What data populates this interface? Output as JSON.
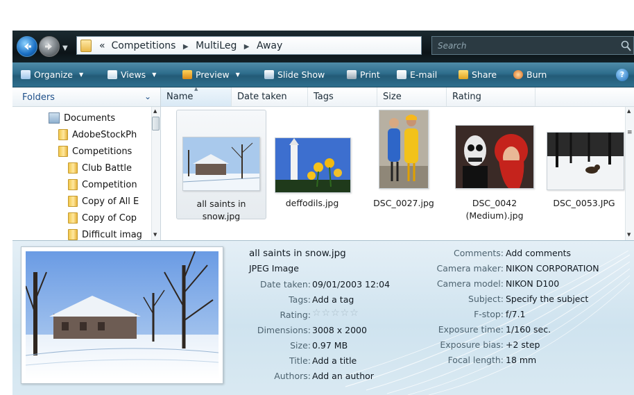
{
  "address": {
    "path": [
      "Competitions",
      "MultiLeg",
      "Away"
    ],
    "chevron": "«",
    "search_placeholder": "Search"
  },
  "toolbar": {
    "items": [
      {
        "label": "Organize",
        "icon": "organize-icon",
        "dropdown": true
      },
      {
        "label": "Views",
        "icon": "views-icon",
        "dropdown": true
      },
      {
        "label": "Preview",
        "icon": "preview-icon",
        "dropdown": true
      },
      {
        "label": "Slide Show",
        "icon": "slideshow-icon",
        "dropdown": false
      },
      {
        "label": "Print",
        "icon": "print-icon",
        "dropdown": false
      },
      {
        "label": "E-mail",
        "icon": "email-icon",
        "dropdown": false
      },
      {
        "label": "Share",
        "icon": "share-icon",
        "dropdown": false
      },
      {
        "label": "Burn",
        "icon": "burn-icon",
        "dropdown": false
      }
    ],
    "help": "?"
  },
  "folders": {
    "title": "Folders",
    "items": [
      {
        "label": "Documents",
        "icon": "documents-icon"
      },
      {
        "label": "AdobeStockPh",
        "icon": "folder-icon"
      },
      {
        "label": "Competitions",
        "icon": "folder-icon"
      },
      {
        "label": "Club Battle",
        "icon": "folder-icon"
      },
      {
        "label": "Competition",
        "icon": "folder-icon"
      },
      {
        "label": "Copy of All E",
        "icon": "folder-icon"
      },
      {
        "label": "Copy of Cop",
        "icon": "folder-icon"
      },
      {
        "label": "Difficult imag",
        "icon": "folder-icon"
      }
    ]
  },
  "columns": [
    "Name",
    "Date taken",
    "Tags",
    "Size",
    "Rating"
  ],
  "files": [
    {
      "name": "all saints in snow.jpg",
      "line1": "all saints in",
      "line2": "snow.jpg",
      "selected": true
    },
    {
      "name": "deffodils.jpg",
      "line1": "deffodils.jpg",
      "line2": "",
      "selected": false
    },
    {
      "name": "DSC_0027.jpg",
      "line1": "DSC_0027.jpg",
      "line2": "",
      "selected": false
    },
    {
      "name": "DSC_0042 (Medium).jpg",
      "line1": "DSC_0042",
      "line2": "(Medium).jpg",
      "selected": false
    },
    {
      "name": "DSC_0053.JPG",
      "line1": "DSC_0053.JPG",
      "line2": "",
      "selected": false
    }
  ],
  "details": {
    "filename": "all saints in snow.jpg",
    "filetype": "JPEG Image",
    "left": [
      {
        "label": "Date taken:",
        "value": "09/01/2003 12:04"
      },
      {
        "label": "Tags:",
        "value": "Add a tag"
      },
      {
        "label": "Rating:",
        "value": "☆☆☆☆☆"
      },
      {
        "label": "Dimensions:",
        "value": "3008 x 2000"
      },
      {
        "label": "Size:",
        "value": "0.97 MB"
      },
      {
        "label": "Title:",
        "value": "Add a title"
      },
      {
        "label": "Authors:",
        "value": "Add an author"
      }
    ],
    "right": [
      {
        "label": "Comments:",
        "value": "Add comments"
      },
      {
        "label": "Camera maker:",
        "value": "NIKON CORPORATION"
      },
      {
        "label": "Camera model:",
        "value": "NIKON D100"
      },
      {
        "label": "Subject:",
        "value": "Specify the subject"
      },
      {
        "label": "F-stop:",
        "value": "f/7.1"
      },
      {
        "label": "Exposure time:",
        "value": "1/160 sec."
      },
      {
        "label": "Exposure bias:",
        "value": "+2 step"
      },
      {
        "label": "Focal length:",
        "value": "18 mm"
      }
    ]
  }
}
